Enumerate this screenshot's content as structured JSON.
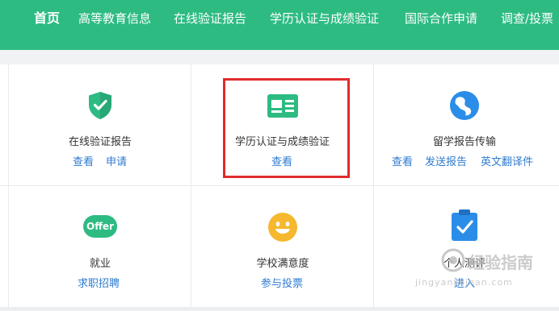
{
  "nav": {
    "items": [
      "首页",
      "高等教育信息",
      "在线验证报告",
      "学历认证与成绩验证",
      "国际合作申请",
      "调查/投票"
    ]
  },
  "cells": {
    "online_report": {
      "label": "在线验证报告",
      "links": [
        "查看",
        "申请"
      ],
      "icon": "shield-check-icon"
    },
    "degree_cert": {
      "label": "学历认证与成绩验证",
      "links": [
        "查看"
      ],
      "icon": "id-card-icon"
    },
    "study_abroad": {
      "label": "留学报告传输",
      "links": [
        "查看",
        "发送报告",
        "英文翻译件"
      ],
      "icon": "globe-icon"
    },
    "employment": {
      "label": "就业",
      "links": [
        "求职招聘"
      ],
      "icon": "offer-badge-icon",
      "badge_text": "Offer"
    },
    "school_satisfaction": {
      "label": "学校满意度",
      "links": [
        "参与投票"
      ],
      "icon": "smiley-icon"
    },
    "personal_eval": {
      "label": "个人测评",
      "links": [
        "进入"
      ],
      "icon": "clipboard-check-icon"
    }
  },
  "watermark": {
    "title": "经验指南",
    "domain": "jingyanzhinan.com"
  },
  "colors": {
    "nav_green": "#2dbb82",
    "link_blue": "#2e7bd1",
    "highlight_red": "#e22b2b",
    "icon_blue": "#2c8de8",
    "icon_yellow": "#f5b82e"
  }
}
